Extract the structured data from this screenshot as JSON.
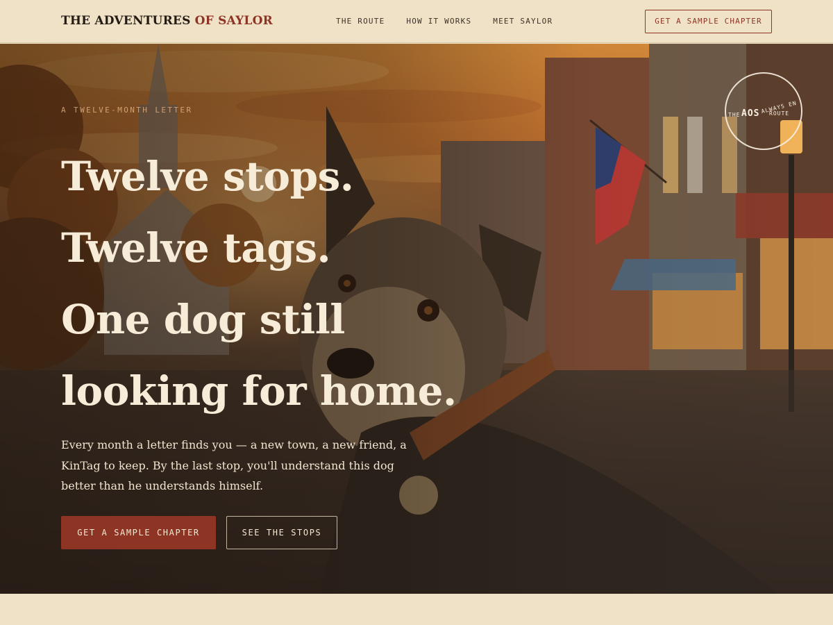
{
  "nav": {
    "brand_main": "THE ADVENTURES ",
    "brand_accent": "OF SAYLOR",
    "links": [
      {
        "label": "THE ROUTE"
      },
      {
        "label": "HOW IT WORKS"
      },
      {
        "label": "MEET SAYLOR"
      }
    ],
    "cta_label": "GET A SAMPLE CHAPTER"
  },
  "hero": {
    "eyebrow": "A TWELVE-MONTH LETTER",
    "headline_lines": [
      "Twelve stops.",
      "Twelve tags.",
      "One dog still",
      "looking for home."
    ],
    "lede": "Every month a letter finds you — a new town, a new friend, a KinTag to keep. By the last stop, you'll understand this dog better than he understands himself.",
    "primary_cta": "GET A SAMPLE CHAPTER",
    "secondary_cta": "SEE THE STOPS",
    "stamp": {
      "main": "AOS",
      "left": "THE",
      "top": "ALWAYS EN",
      "bottom": "ROUTE"
    }
  },
  "colors": {
    "background": "#efe2c6",
    "accent": "#8e3425",
    "hero_text": "#f7ecd8",
    "ink": "#231b14"
  }
}
